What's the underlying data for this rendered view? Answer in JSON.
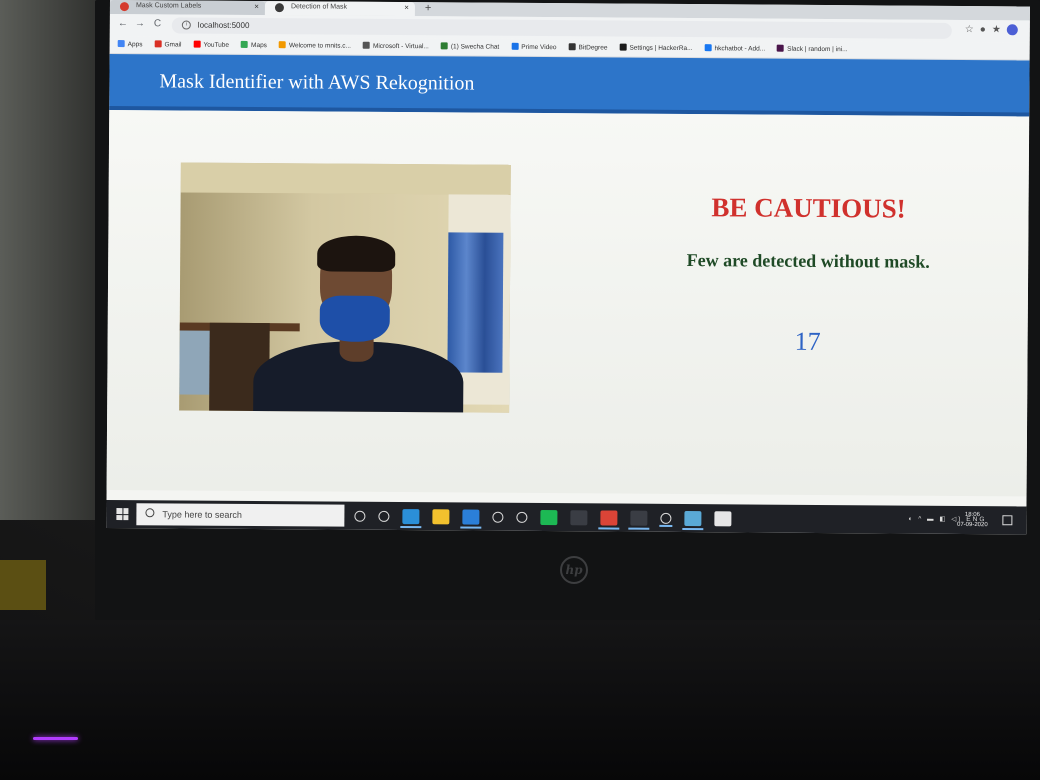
{
  "browser": {
    "tabs": [
      {
        "label": "Mask Custom Labels",
        "close": "×"
      },
      {
        "label": "Detection of Mask",
        "close": "×"
      }
    ],
    "new_tab": "+",
    "url": "localhost:5000",
    "bookmarks": [
      {
        "label": "Apps",
        "color": "#4285f4"
      },
      {
        "label": "Gmail",
        "color": "#d93025"
      },
      {
        "label": "YouTube",
        "color": "#ff0000"
      },
      {
        "label": "Maps",
        "color": "#34a853"
      },
      {
        "label": "Welcome to mnits.c...",
        "color": "#f29900"
      },
      {
        "label": "Microsoft - Virtual...",
        "color": "#555555"
      },
      {
        "label": "(1) Swecha Chat",
        "color": "#2e7d32"
      },
      {
        "label": "Prime Video",
        "color": "#1a73e8"
      },
      {
        "label": "BitDegree",
        "color": "#333333"
      },
      {
        "label": "Settings | HackerRa...",
        "color": "#1b1b1b"
      },
      {
        "label": "hkchatbot - Add...",
        "color": "#1877f2"
      },
      {
        "label": "Slack | random | ini...",
        "color": "#4a154b"
      }
    ]
  },
  "app": {
    "title": "Mask Identifier with AWS Rekognition"
  },
  "status": {
    "title": "BE CAUTIOUS!",
    "message": "Few are detected without mask.",
    "count": "17",
    "title_color": "#d0312d",
    "message_color": "#1f4a26",
    "count_color": "#2d63c5"
  },
  "taskbar": {
    "search_placeholder": "Type here to search",
    "apps": [
      {
        "name": "cortana-icon",
        "color": "#1f2126"
      },
      {
        "name": "task-view-icon",
        "color": "#1f2126"
      },
      {
        "name": "edge-icon",
        "color": "#2b8fd8"
      },
      {
        "name": "file-explorer-icon",
        "color": "#f2c12e"
      },
      {
        "name": "mail-icon",
        "color": "#2b7fd8"
      },
      {
        "name": "dropbox-icon",
        "color": "#1f2126"
      },
      {
        "name": "winamp-icon",
        "color": "#1f2126"
      },
      {
        "name": "spotify-icon",
        "color": "#1db954"
      },
      {
        "name": "calculator-icon",
        "color": "#3a3d44"
      },
      {
        "name": "chrome-icon",
        "color": "#db4437"
      },
      {
        "name": "terminal-icon",
        "color": "#3a3d44"
      },
      {
        "name": "settings-icon",
        "color": "#1f2126"
      },
      {
        "name": "book-icon",
        "color": "#5aa9d6"
      },
      {
        "name": "notepad-icon",
        "color": "#e6e6e6"
      }
    ],
    "tray_language": "ENG",
    "time": "18:06",
    "date": "07-09-2020"
  },
  "hardware": {
    "brand": "hp"
  }
}
